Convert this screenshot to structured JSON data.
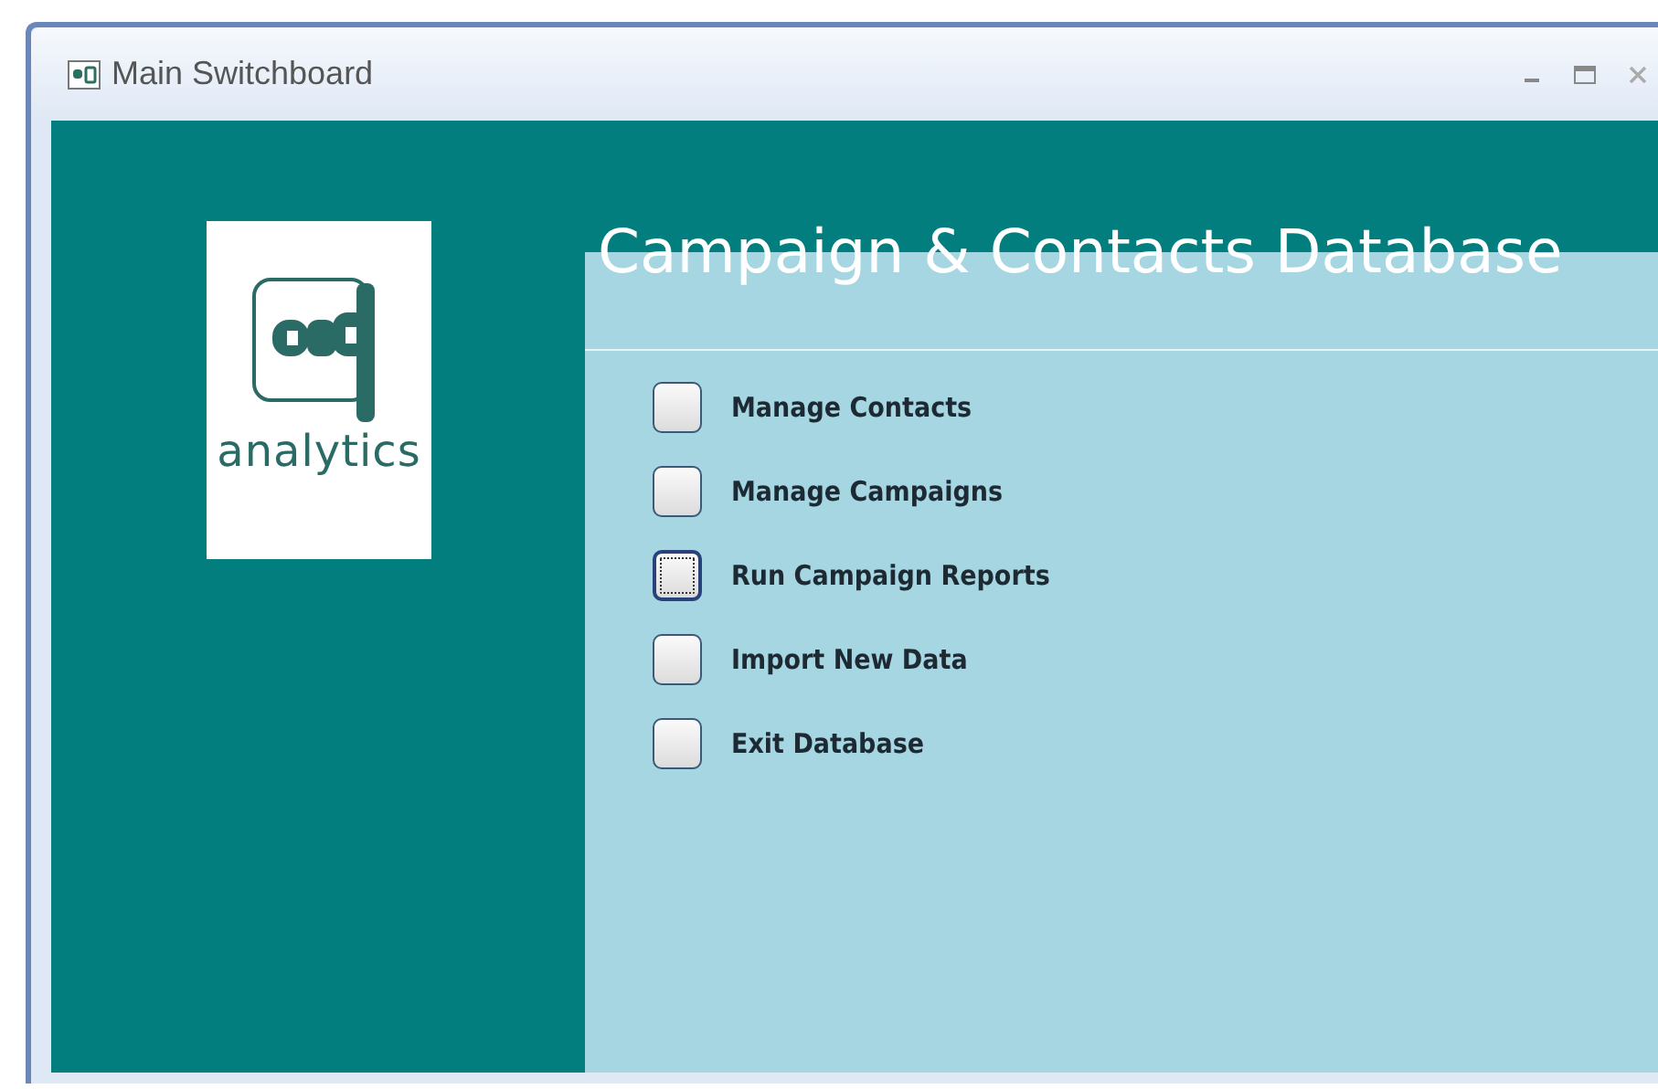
{
  "window": {
    "title": "Main Switchboard"
  },
  "logo": {
    "text": "analytics"
  },
  "header": {
    "title": "Campaign & Contacts Database"
  },
  "menu": [
    {
      "label": "Manage Contacts",
      "focused": false
    },
    {
      "label": "Manage Campaigns",
      "focused": false
    },
    {
      "label": "Run Campaign Reports",
      "focused": true
    },
    {
      "label": "Import New Data",
      "focused": false
    },
    {
      "label": "Exit Database",
      "focused": false
    }
  ]
}
